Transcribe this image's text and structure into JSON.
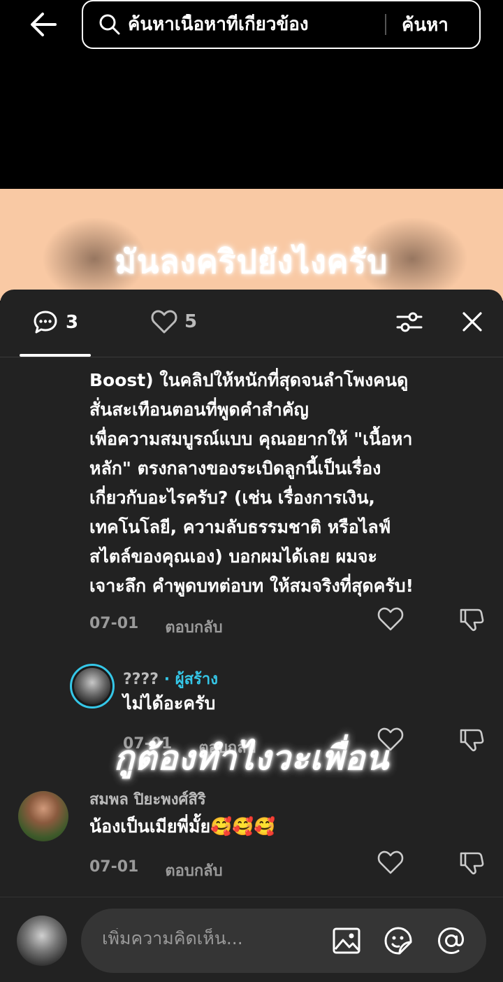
{
  "search": {
    "placeholder": "ค้นหาเนื้อหาที่เกี่ยวข้อง",
    "button_label": "ค้นหา"
  },
  "video": {
    "caption": "มันลงคริปยังไงครับ",
    "overlay_caption": "กูต้องทำไงวะเพื่อน"
  },
  "tabs": {
    "comments_count": "3",
    "likes_count": "5"
  },
  "comments": [
    {
      "lines": [
        "Boost) ในคลิปให้หนักที่สุดจนลำโพงคนดู",
        "สั่นสะเทือนตอนที่พูดคำสำคัญ",
        "เพื่อความสมบูรณ์แบบ คุณอยากให้ \"เนื้อหา",
        "หลัก\" ตรงกลางของระเบิดลูกนี้เป็นเรื่อง",
        "เกี่ยวกับอะไรครับ? (เช่น เรื่องการเงิน,",
        "เทคโนโลยี, ความลับธรรมชาติ หรือไลฟ์",
        "สไตล์ของคุณเอง) บอกผมได้เลย ผมจะ",
        "เจาะลึก คำพูดบทต่อบท ให้สมจริงที่สุดครับ!"
      ],
      "date": "07-01",
      "reply_label": "ตอบกลับ"
    },
    {
      "author": "????",
      "creator_tag": "· ผู้สร้าง",
      "text": "ไม่ได้อะครับ",
      "date": "07-01",
      "reply_label": "ตอบกลับ"
    },
    {
      "author": "สมพล ปิยะพงศ์สิริ",
      "text": "น้องเป็นเมียพี่มั้ย🥰🥰🥰",
      "date": "07-01",
      "reply_label": "ตอบกลับ"
    }
  ],
  "composer": {
    "placeholder": "เพิ่มความคิดเห็น..."
  },
  "icons": {
    "back": "arrow-left-icon",
    "search": "search-icon",
    "comment": "comment-bubble-icon",
    "like": "heart-icon",
    "filter": "sliders-icon",
    "close": "close-icon",
    "dislike": "thumbs-down-icon",
    "image": "image-icon",
    "sticker": "sticker-icon",
    "mention": "at-icon"
  },
  "colors": {
    "panel": "#222222",
    "creator_accent": "#35c7e8",
    "video_bg": "#f9c9a4"
  }
}
